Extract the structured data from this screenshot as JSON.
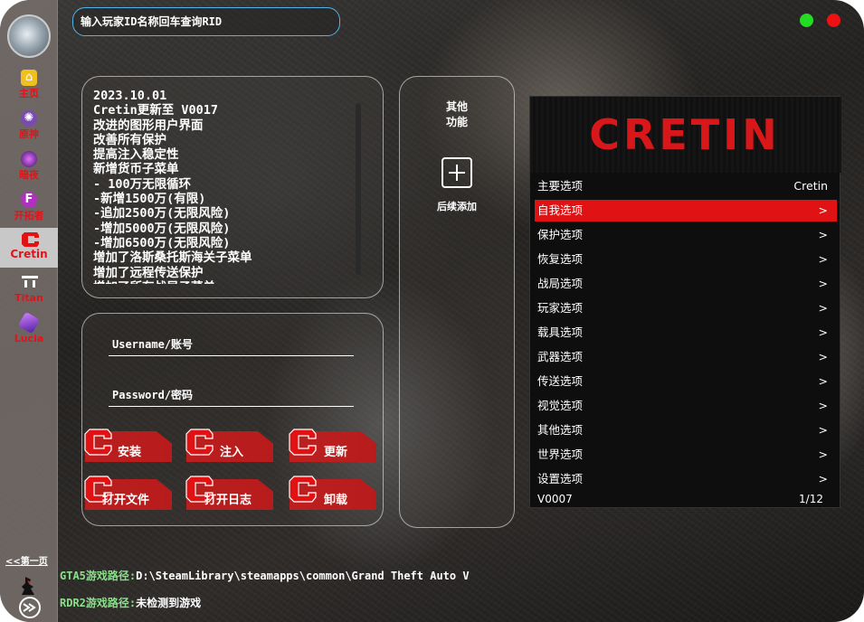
{
  "search": {
    "placeholder": "输入玩家ID名称回车查询RID"
  },
  "window_controls": {
    "green": "#22dd22",
    "red": "#ee1111"
  },
  "sidebar": {
    "items": [
      {
        "label": "主页",
        "icon": "home-icon"
      },
      {
        "label": "原神",
        "icon": "atom-icon"
      },
      {
        "label": "暗夜",
        "icon": "orb-icon"
      },
      {
        "label": "开拓者",
        "icon": "f-badge-icon"
      },
      {
        "label": "Cretin",
        "icon": "cretin-logo-icon"
      },
      {
        "label": "Titan",
        "icon": "titan-logo-icon"
      },
      {
        "label": "Lucia",
        "icon": "lucia-gem-icon"
      }
    ],
    "prev_page": "<<第一页"
  },
  "changelog": {
    "lines": [
      "2023.10.01",
      "Cretin更新至 V0017",
      "改进的图形用户界面",
      "改善所有保护",
      "提高注入稳定性",
      "新增货币子菜单",
      "- 100万无限循环",
      "-新增1500万(有限)",
      "-追加2500万(无限风险)",
      "-增加5000万(无限风险)",
      "-增加6500万(无限风险)",
      "增加了洛斯桑托斯海关子菜单",
      "增加了远程传送保护",
      "增加了所有战局子菜单"
    ]
  },
  "other": {
    "title_line1": "其他",
    "title_line2": "功能",
    "add_label": "后续添加"
  },
  "login": {
    "username_label": "Username/账号",
    "password_label": "Password/密码"
  },
  "actions": {
    "install": "安装",
    "inject": "注入",
    "update": "更新",
    "open_file": "打开文件",
    "open_log": "打开日志",
    "uninstall": "卸载"
  },
  "menu": {
    "brand": "CRETIN",
    "rows": [
      {
        "label": "主要选项",
        "value": "Cretin",
        "selected": false
      },
      {
        "label": "自我选项",
        "value": ">",
        "selected": true
      },
      {
        "label": "保护选项",
        "value": ">",
        "selected": false
      },
      {
        "label": "恢复选项",
        "value": ">",
        "selected": false
      },
      {
        "label": "战局选项",
        "value": ">",
        "selected": false
      },
      {
        "label": "玩家选项",
        "value": ">",
        "selected": false
      },
      {
        "label": "载具选项",
        "value": ">",
        "selected": false
      },
      {
        "label": "武器选项",
        "value": ">",
        "selected": false
      },
      {
        "label": "传送选项",
        "value": ">",
        "selected": false
      },
      {
        "label": "视觉选项",
        "value": ">",
        "selected": false
      },
      {
        "label": "其他选项",
        "value": ">",
        "selected": false
      },
      {
        "label": "世界选项",
        "value": ">",
        "selected": false
      },
      {
        "label": "设置选项",
        "value": ">",
        "selected": false
      }
    ],
    "version": "V0007",
    "page": "1/12",
    "accent": "#e01214"
  },
  "paths": {
    "gta5_key": "GTA5游戏路径:",
    "gta5_value": "D:\\SteamLibrary\\steamapps\\common\\Grand Theft Auto V",
    "rdr2_key": "RDR2游戏路径:",
    "rdr2_value": "未检测到游戏"
  }
}
